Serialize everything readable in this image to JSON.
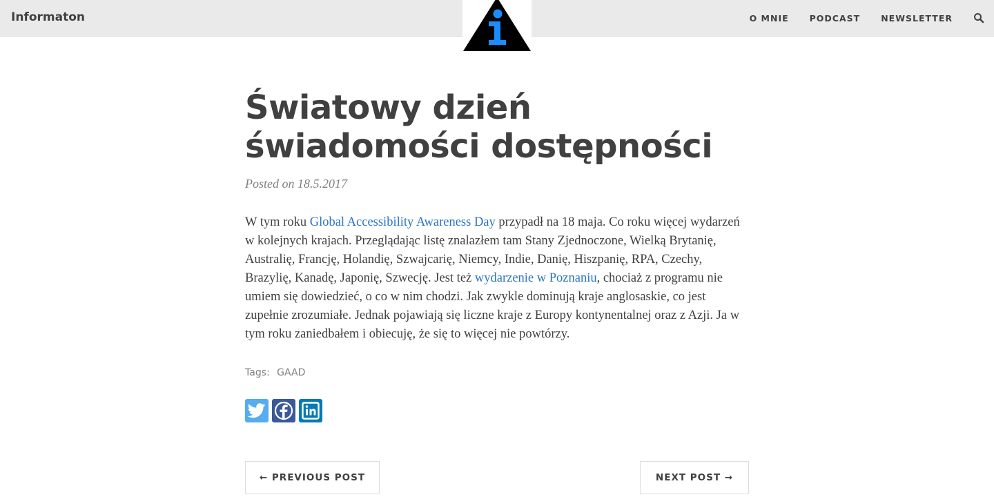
{
  "navbar": {
    "brand": "Informaton",
    "links": [
      {
        "label": "O MNIE"
      },
      {
        "label": "PODCAST"
      },
      {
        "label": "NEWSLETTER"
      }
    ],
    "search_icon": "search-icon",
    "logo_icon": "information-triangle-logo",
    "logo_letter": "i"
  },
  "post": {
    "title": "Światowy dzień świadomości dostępności",
    "meta_prefix": "Posted on",
    "date": "18.5.2017",
    "body": {
      "t1": "W tym roku ",
      "link1": "Global Accessibility Awareness Day",
      "t2": " przypadł na 18 maja. Co roku więcej wydarzeń w kolejnych krajach. Przeglądając listę znalazłem tam Stany Zjednoczone, Wielką Brytanię, Australię, Francję, Holandię, Szwajcarię, Niemcy, Indie, Danię, Hiszpanię, RPA, Czechy, Brazylię, Kanadę, Japonię, Szwecję. Jest też ",
      "link2": "wydarzenie w Poznaniu",
      "t3": ", chociaż z programu nie umiem się dowiedzieć, o co w nim chodzi. Jak zwykle dominują kraje anglosaskie, co jest zupełnie zrozumiałe. Jednak pojawiają się liczne kraje z Europy kontynentalnej oraz z Azji. Ja w tym roku zaniedbałem i obiecuję, że się to więcej nie powtórzy."
    },
    "tags_label": "Tags:",
    "tags": [
      "GAAD"
    ]
  },
  "share": [
    {
      "name": "twitter-icon",
      "color": "#55acee"
    },
    {
      "name": "facebook-icon",
      "color": "#3b5998"
    },
    {
      "name": "linkedin-icon",
      "color": "#007bb6"
    }
  ],
  "pager": {
    "prev_label": "← PREVIOUS POST",
    "next_label": "NEXT POST →"
  },
  "colors": {
    "navbar_bg": "#eaeaea",
    "text": "#404040",
    "link": "#2a74c4",
    "logo_blue": "#1a8cff",
    "logo_dark": "#000000"
  }
}
